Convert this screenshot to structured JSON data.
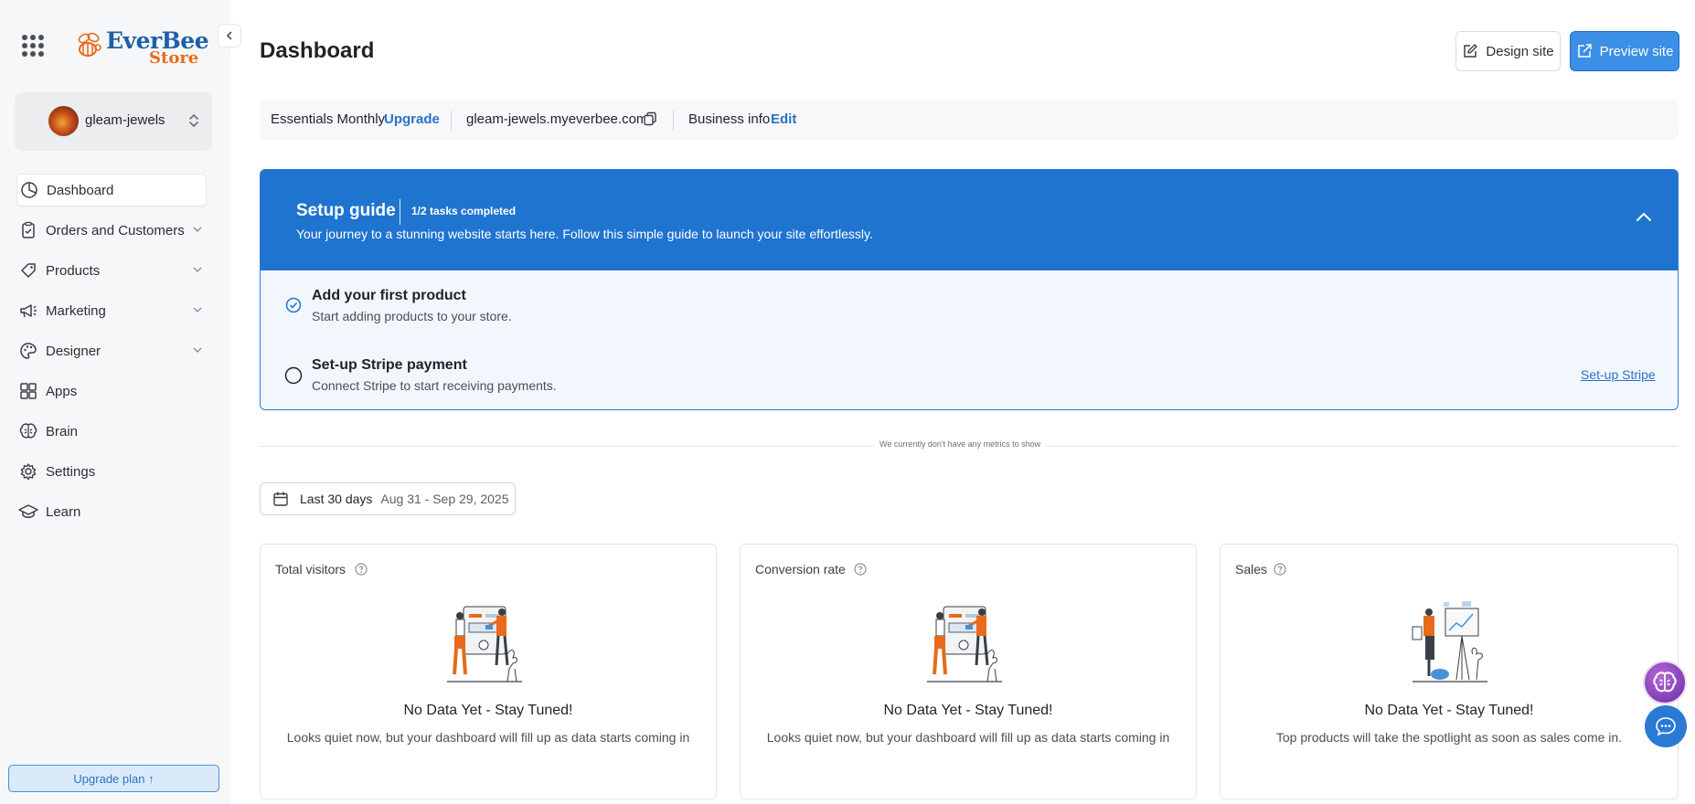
{
  "app": {
    "brand_primary": "EverBee",
    "brand_secondary": "Store",
    "accent_color": "#1f74cf"
  },
  "store": {
    "name": "gleam-jewels"
  },
  "sidebar": {
    "items": [
      {
        "label": "Dashboard",
        "icon": "chart-pie-icon",
        "active": true
      },
      {
        "label": "Orders and Customers",
        "icon": "clipboard-icon",
        "expandable": true
      },
      {
        "label": "Products",
        "icon": "tag-icon",
        "expandable": true
      },
      {
        "label": "Marketing",
        "icon": "megaphone-icon",
        "expandable": true
      },
      {
        "label": "Designer",
        "icon": "palette-icon",
        "expandable": true
      },
      {
        "label": "Apps",
        "icon": "apps-icon"
      },
      {
        "label": "Brain",
        "icon": "brain-icon"
      },
      {
        "label": "Settings",
        "icon": "gear-icon"
      },
      {
        "label": "Learn",
        "icon": "graduation-cap-icon"
      }
    ],
    "upgrade_label": "Upgrade plan ↑"
  },
  "header": {
    "title": "Dashboard",
    "design_label": "Design site",
    "preview_label": "Preview site"
  },
  "info_bar": {
    "plan": "Essentials Monthly",
    "upgrade_link": "Upgrade",
    "domain": "gleam-jewels.myeverbee.com",
    "business_label": "Business info",
    "edit_link": "Edit"
  },
  "setup_guide": {
    "title": "Setup guide",
    "progress": "1/2 tasks completed",
    "description": "Your journey to a stunning website starts here. Follow this simple guide to launch your site effortlessly.",
    "tasks": [
      {
        "title": "Add your first product",
        "subtitle": "Start adding products to your store.",
        "done": true
      },
      {
        "title": "Set-up Stripe payment",
        "subtitle": "Connect Stripe to start receiving payments.",
        "done": false,
        "action": "Set-up Stripe"
      }
    ]
  },
  "metrics_note": "We currently don't have any metrics to show",
  "date_filter": {
    "label": "Last 30 days",
    "range": "Aug 31 - Sep 29, 2025"
  },
  "cards": [
    {
      "title": "Total visitors",
      "heading": "No Data Yet - Stay Tuned!",
      "subtitle": "Looks quiet now, but your dashboard will fill up as data starts coming in"
    },
    {
      "title": "Conversion rate",
      "heading": "No Data Yet - Stay Tuned!",
      "subtitle": "Looks quiet now, but your dashboard will fill up as data starts coming in"
    },
    {
      "title": "Sales",
      "heading": "No Data Yet - Stay Tuned!",
      "subtitle": "Top products will take the spotlight as soon as sales come in."
    }
  ]
}
